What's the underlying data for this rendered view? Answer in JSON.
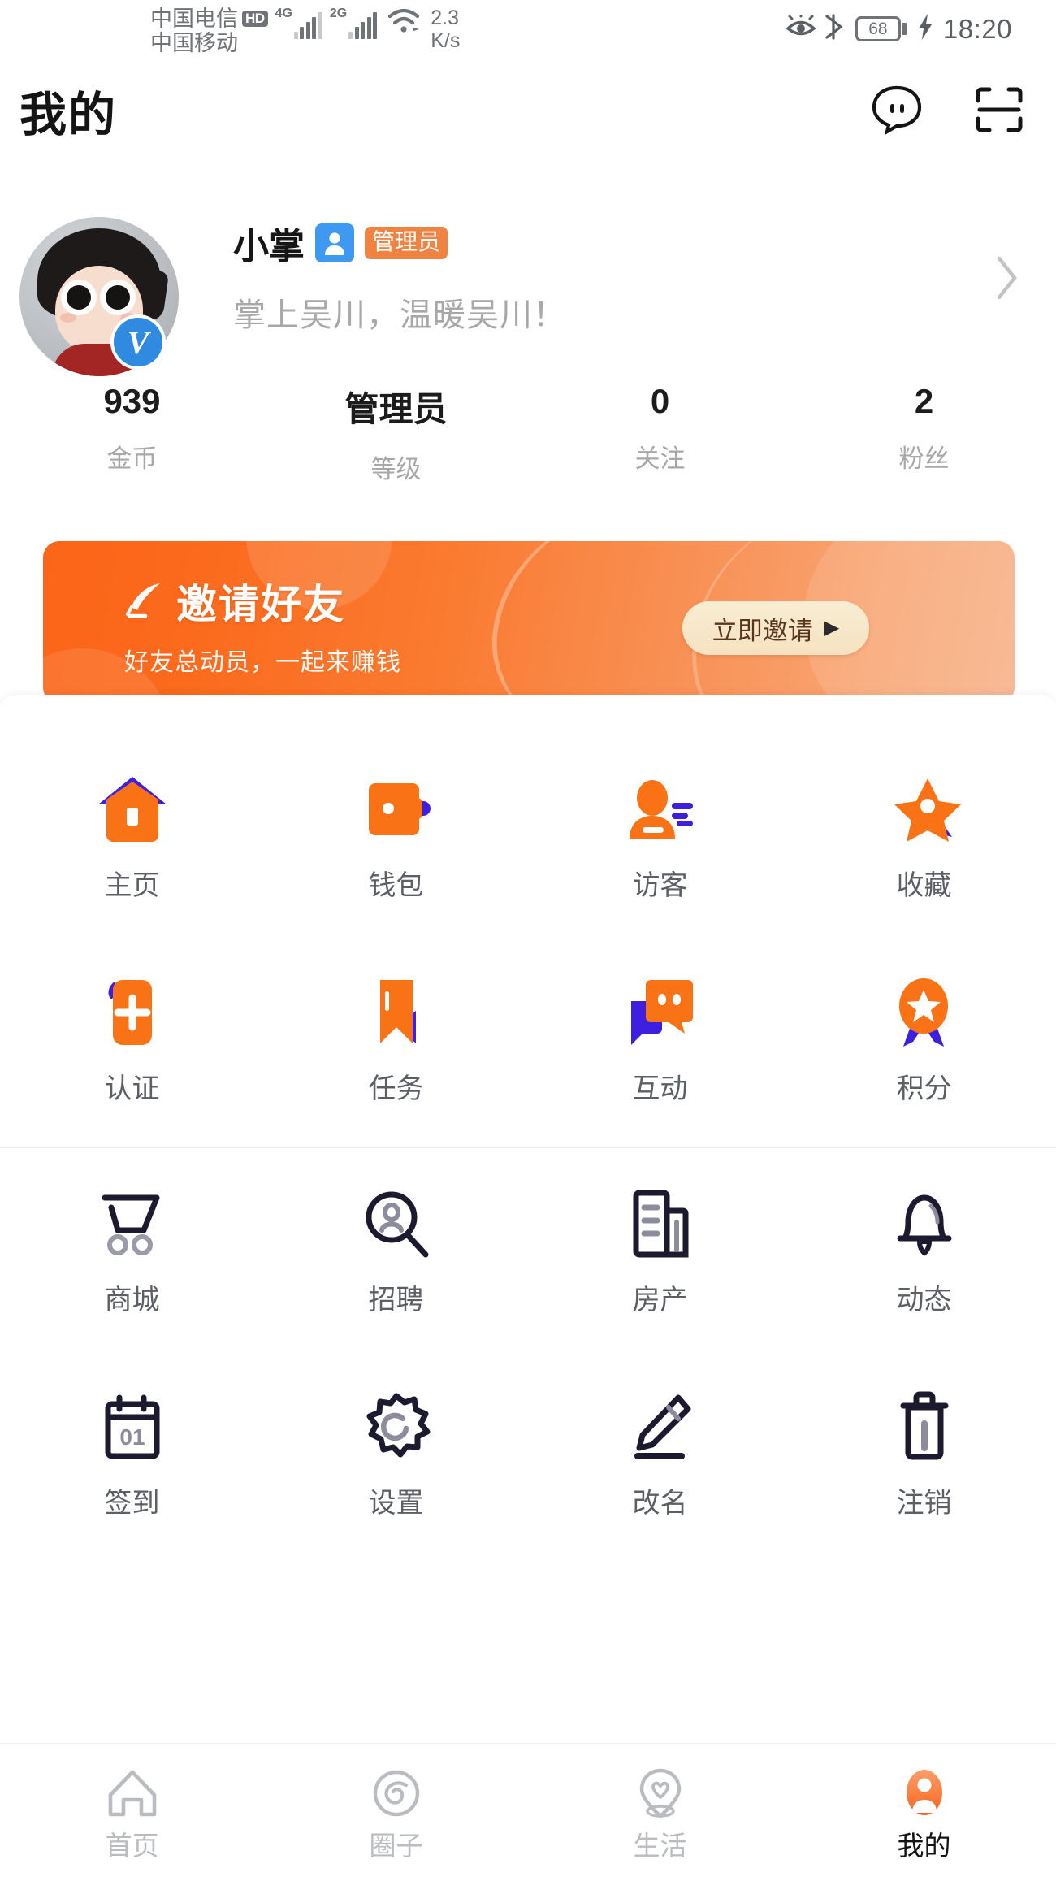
{
  "status_bar": {
    "carrier_primary": "中国电信",
    "carrier_secondary": "中国移动",
    "hd_badge": "HD",
    "net_gen_primary": "4G",
    "net_gen_secondary": "2G",
    "net_speed_value": "2.3",
    "net_speed_unit": "K/s",
    "battery_percent": "68",
    "time": "18:20",
    "icons": [
      "eye-comfort-icon",
      "bluetooth-icon",
      "battery-icon",
      "charging-bolt-icon"
    ]
  },
  "header": {
    "title": "我的",
    "chat_icon": "chat-bubble-icon",
    "scan_icon": "qr-scan-icon"
  },
  "profile": {
    "name": "小掌",
    "admin_badge": "管理员",
    "bio": "掌上吴川，温暖吴川！",
    "verified_mark": "V",
    "avatar_icon": "user-avatar",
    "chevron_icon": "chevron-right-icon"
  },
  "stats": [
    {
      "value": "939",
      "label": "金币"
    },
    {
      "value": "管理员",
      "label": "等级"
    },
    {
      "value": "0",
      "label": "关注"
    },
    {
      "value": "2",
      "label": "粉丝"
    }
  ],
  "banner": {
    "title": "邀请好友",
    "subtitle": "好友总动员，一起来赚钱",
    "title_icon": "feather-quill-icon",
    "button_label": "立即邀请",
    "button_arrow": "▶",
    "gradient_from": "#FB6518",
    "gradient_to": "#F7B187",
    "button_bg": "#F6E7CA",
    "button_text_color": "#59351B"
  },
  "grid_colored": [
    {
      "label": "主页",
      "icon": "house-icon"
    },
    {
      "label": "钱包",
      "icon": "wallet-icon"
    },
    {
      "label": "访客",
      "icon": "visitor-person-icon"
    },
    {
      "label": "收藏",
      "icon": "star-favorite-icon"
    },
    {
      "label": "认证",
      "icon": "verify-card-plus-icon"
    },
    {
      "label": "任务",
      "icon": "bookmark-task-icon"
    },
    {
      "label": "互动",
      "icon": "chat-interaction-icon"
    },
    {
      "label": "积分",
      "icon": "medal-star-icon"
    }
  ],
  "grid_outline": [
    {
      "label": "商城",
      "icon": "shopping-cart-icon"
    },
    {
      "label": "招聘",
      "icon": "magnifier-person-icon"
    },
    {
      "label": "房产",
      "icon": "buildings-icon"
    },
    {
      "label": "动态",
      "icon": "bell-icon"
    },
    {
      "label": "签到",
      "icon": "calendar-01-icon"
    },
    {
      "label": "设置",
      "icon": "gear-icon"
    },
    {
      "label": "改名",
      "icon": "pencil-rename-icon"
    },
    {
      "label": "注销",
      "icon": "trash-delete-icon"
    }
  ],
  "tabbar": [
    {
      "label": "首页",
      "icon": "home-outline-icon",
      "active": false
    },
    {
      "label": "圈子",
      "icon": "spiral-circle-icon",
      "active": false
    },
    {
      "label": "生活",
      "icon": "heart-pin-icon",
      "active": false
    },
    {
      "label": "我的",
      "icon": "person-filled-icon",
      "active": true
    }
  ],
  "theme": {
    "accent_orange": "#F97316",
    "accent_blue": "#3E1FE0",
    "icon_outline": "#1B1A2E",
    "label_gray": "#5C6066",
    "muted_gray": "#A8A8A8"
  }
}
